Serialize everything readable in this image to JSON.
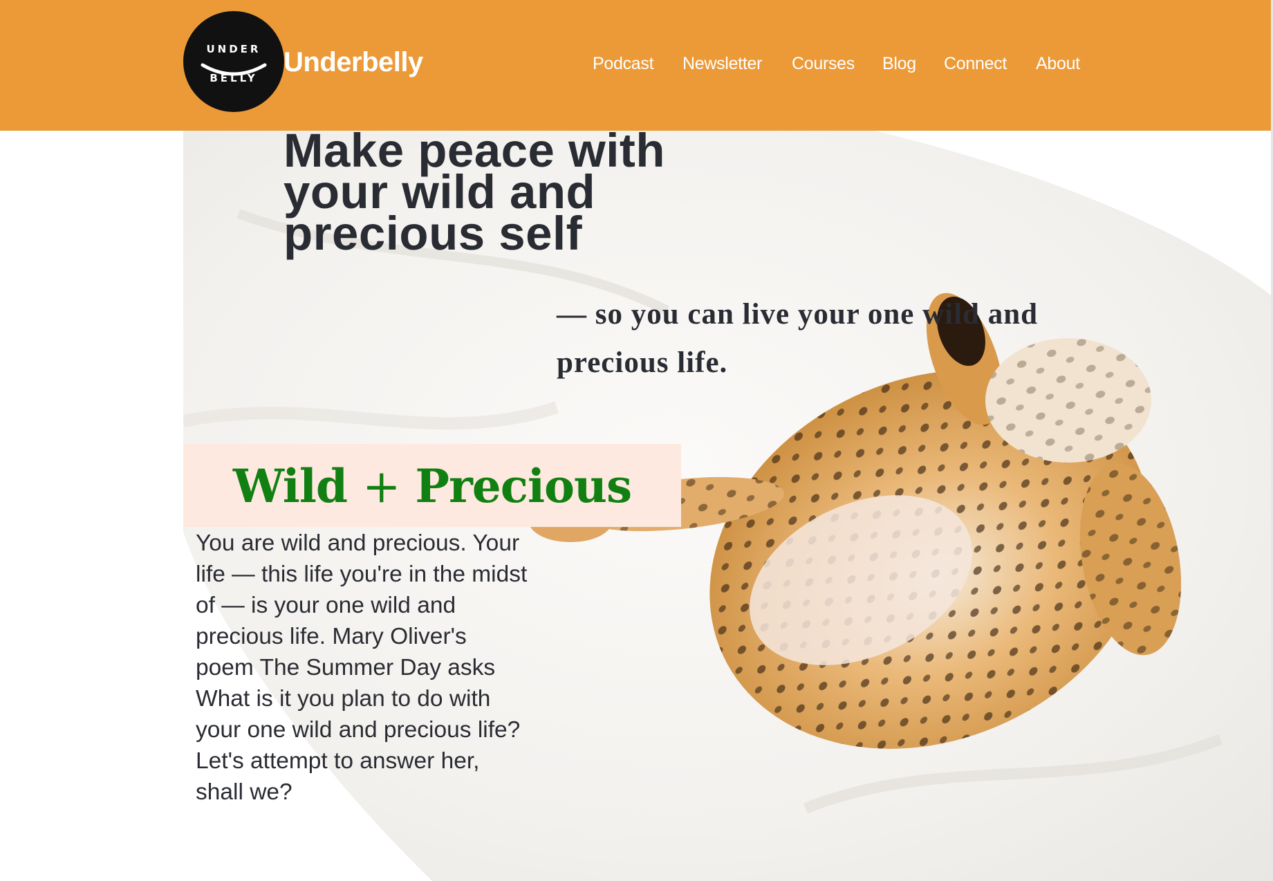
{
  "header": {
    "logo": {
      "top_text": "UNDER",
      "bottom_text": "BELLY"
    },
    "brand": "Underbelly",
    "nav": [
      "Podcast",
      "Newsletter",
      "Courses",
      "Blog",
      "Connect",
      "About"
    ]
  },
  "hero": {
    "headline": "Make peace with your wild and precious self",
    "subline": "— so you can live your one wild and precious life.",
    "callout": {
      "word1": "Wild",
      "plus": "+",
      "word2": "Precious"
    },
    "body": "You are wild and precious. Your life — this life you're in the midst of — is your one wild and precious life. Mary Oliver's poem The Summer Day asks What is it you plan to do with your one wild and precious life? Let's attempt to answer her, shall we?"
  },
  "colors": {
    "header_bg": "#ec9a38",
    "text_dark": "#2a2c33",
    "callout_bg": "#fde9df",
    "callout_text": "#117f11"
  },
  "icons": [
    "smile-arc-icon",
    "cat-photo"
  ]
}
